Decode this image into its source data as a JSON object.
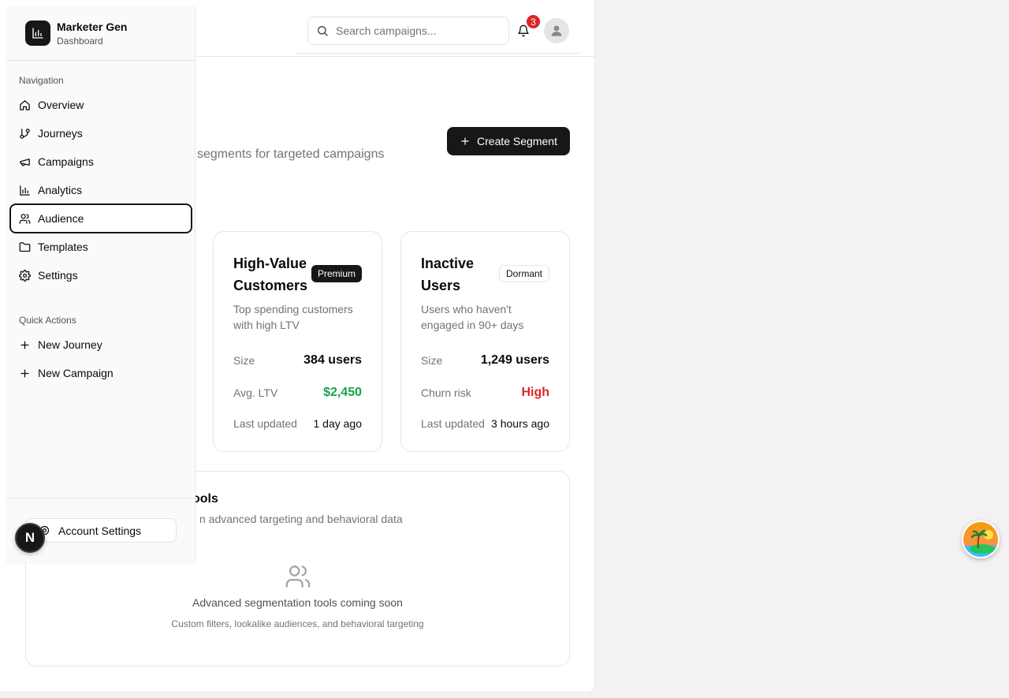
{
  "header": {
    "search_placeholder": "Search campaigns...",
    "notification_count": "3"
  },
  "page": {
    "subtitle": "segments for targeted campaigns",
    "create_button": "Create Segment"
  },
  "cards": [
    {
      "title": "High-Value Customers",
      "tag": "Premium",
      "description": "Top spending customers with high LTV",
      "rows": [
        {
          "label": "Size",
          "value": "384 users"
        },
        {
          "label": "Avg. LTV",
          "value": "$2,450"
        },
        {
          "label": "Last updated",
          "value": "1 day ago"
        }
      ]
    },
    {
      "title": "Inactive Users",
      "tag": "Dormant",
      "description": "Users who haven't engaged in 90+ days",
      "rows": [
        {
          "label": "Size",
          "value": "1,249 users"
        },
        {
          "label": "Churn risk",
          "value": "High"
        },
        {
          "label": "Last updated",
          "value": "3 hours ago"
        }
      ]
    }
  ],
  "tools": {
    "title": "ools",
    "description": "n advanced targeting and behavioral data",
    "message": "Advanced segmentation tools coming soon",
    "submessage": "Custom filters, lookalike audiences, and behavioral targeting"
  },
  "sidebar": {
    "brand_name": "Marketer Gen",
    "brand_sub": "Dashboard",
    "nav_group": "Navigation",
    "items": [
      {
        "label": "Overview",
        "icon": "home-icon"
      },
      {
        "label": "Journeys",
        "icon": "git-branch-icon"
      },
      {
        "label": "Campaigns",
        "icon": "megaphone-icon"
      },
      {
        "label": "Analytics",
        "icon": "bar-chart-icon"
      },
      {
        "label": "Audience",
        "icon": "users-icon",
        "active": true
      },
      {
        "label": "Templates",
        "icon": "folder-icon"
      },
      {
        "label": "Settings",
        "icon": "gear-icon"
      }
    ],
    "quick_group": "Quick Actions",
    "quick_actions": [
      {
        "label": "New Journey",
        "icon": "plus-icon"
      },
      {
        "label": "New Campaign",
        "icon": "plus-icon"
      }
    ],
    "account_button": "Account Settings"
  },
  "overlay": {
    "next_badge": "N"
  },
  "colors": {
    "accent": "#171717",
    "positive": "#16a34a",
    "danger": "#dc2626",
    "muted": "#737373"
  }
}
